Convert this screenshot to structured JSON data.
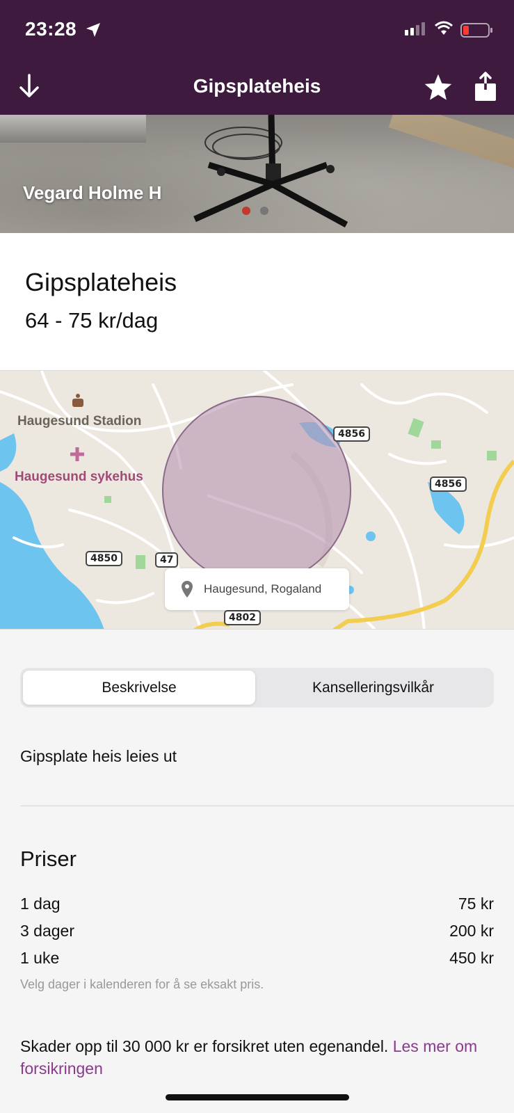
{
  "status_bar": {
    "time": "23:28"
  },
  "nav": {
    "title": "Gipsplateheis"
  },
  "hero": {
    "owner": "Vegard Holme H",
    "image_count": 2,
    "active_index": 0
  },
  "item": {
    "title": "Gipsplateheis",
    "price_range": "64 - 75 kr/dag"
  },
  "map": {
    "labels": {
      "station": "Haugesund Stadion",
      "hospital": "Haugesund sykehus"
    },
    "roads": [
      "4856",
      "4856",
      "4850",
      "47",
      "4802"
    ],
    "location": "Haugesund, Rogaland"
  },
  "tabs": {
    "description": "Beskrivelse",
    "cancellation": "Kanselleringsvilkår"
  },
  "description": "Gipsplate heis leies ut",
  "prices": {
    "heading": "Priser",
    "rows": [
      {
        "period": "1 dag",
        "price": "75 kr"
      },
      {
        "period": "3 dager",
        "price": "200 kr"
      },
      {
        "period": "1 uke",
        "price": "450 kr"
      }
    ],
    "hint": "Velg dager i kalenderen for å se eksakt pris."
  },
  "insurance": {
    "text": "Skader opp til 30 000 kr er forsikret uten egenandel.",
    "link": "Les mer om forsikringen"
  },
  "colors": {
    "brand": "#3f1a3f",
    "accent": "#8a3a8e",
    "radius_fill": "#c9b0c6"
  }
}
